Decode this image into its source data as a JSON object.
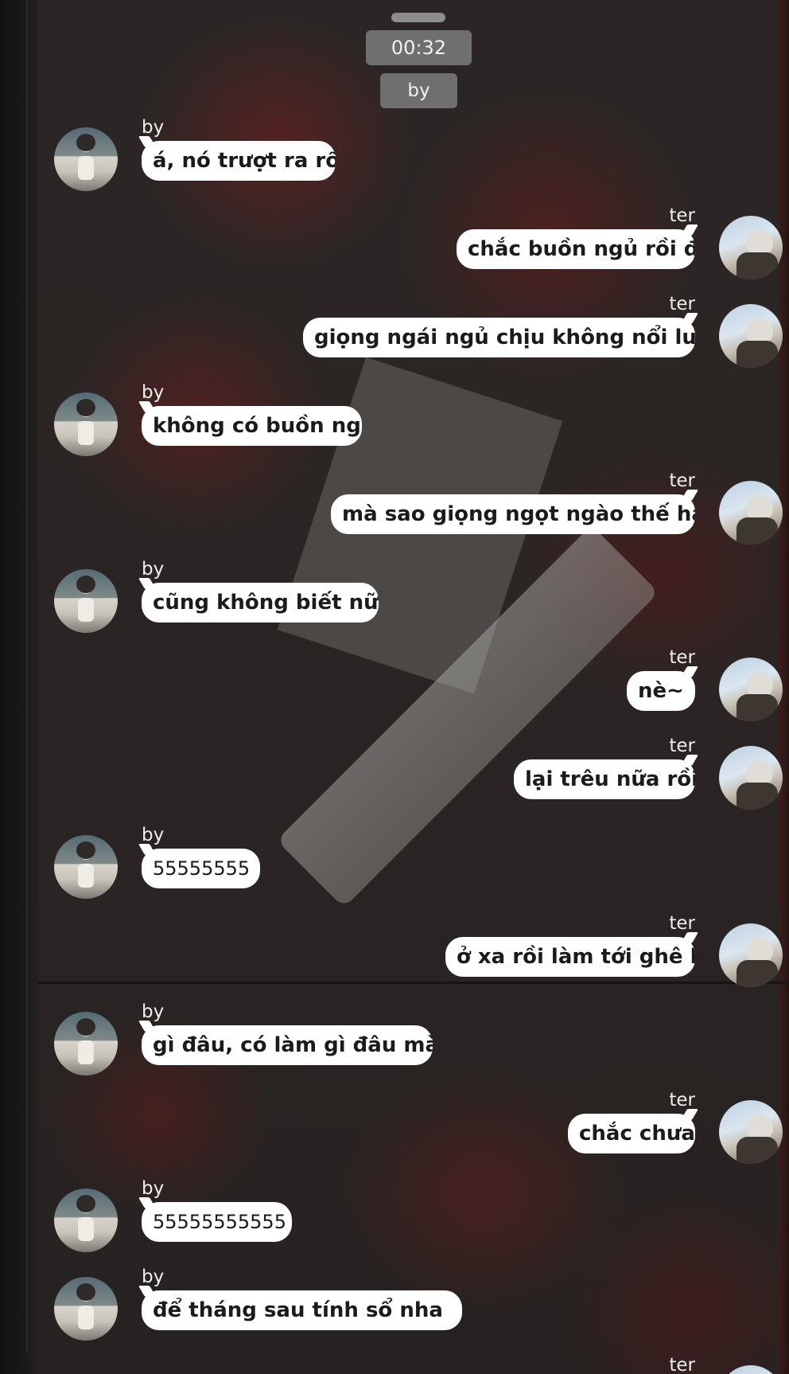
{
  "header": {
    "time": "00:32",
    "contact_name": "by"
  },
  "messages": [
    {
      "sender": "by",
      "side": "left",
      "text": "á, nó trượt ra rồi"
    },
    {
      "sender": "ter",
      "side": "right",
      "text": "chắc buồn ngủ rồi đó"
    },
    {
      "sender": "ter",
      "side": "right",
      "text": "giọng ngái ngủ chịu không nổi luôn"
    },
    {
      "sender": "by",
      "side": "left",
      "text": "không có buồn ngủ"
    },
    {
      "sender": "ter",
      "side": "right",
      "text": "mà sao giọng ngọt ngào thế hả"
    },
    {
      "sender": "by",
      "side": "left",
      "text": "cũng không biết nữa"
    },
    {
      "sender": "ter",
      "side": "right",
      "text": "nè~"
    },
    {
      "sender": "ter",
      "side": "right",
      "text": "lại trêu nữa rồi"
    },
    {
      "sender": "by",
      "side": "left",
      "text": "55555555"
    },
    {
      "sender": "ter",
      "side": "right",
      "text": "ở xa rồi làm tới ghê ha"
    },
    {
      "sender": "by",
      "side": "left",
      "text": "gì đâu, có làm gì đâu mà"
    },
    {
      "sender": "ter",
      "side": "right",
      "text": "chắc chưa"
    },
    {
      "sender": "by",
      "side": "left",
      "text": "55555555555"
    },
    {
      "sender": "by",
      "side": "left",
      "text": "để tháng sau tính sổ nha"
    },
    {
      "sender": "ter",
      "side": "right",
      "text": ""
    }
  ],
  "colors": {
    "bubble": "#ffffff",
    "chip": "#6f6f6f",
    "sender_text": "#eeeeee"
  },
  "icons": {
    "by_avatar": "avatar-by",
    "ter_avatar": "avatar-ter"
  }
}
